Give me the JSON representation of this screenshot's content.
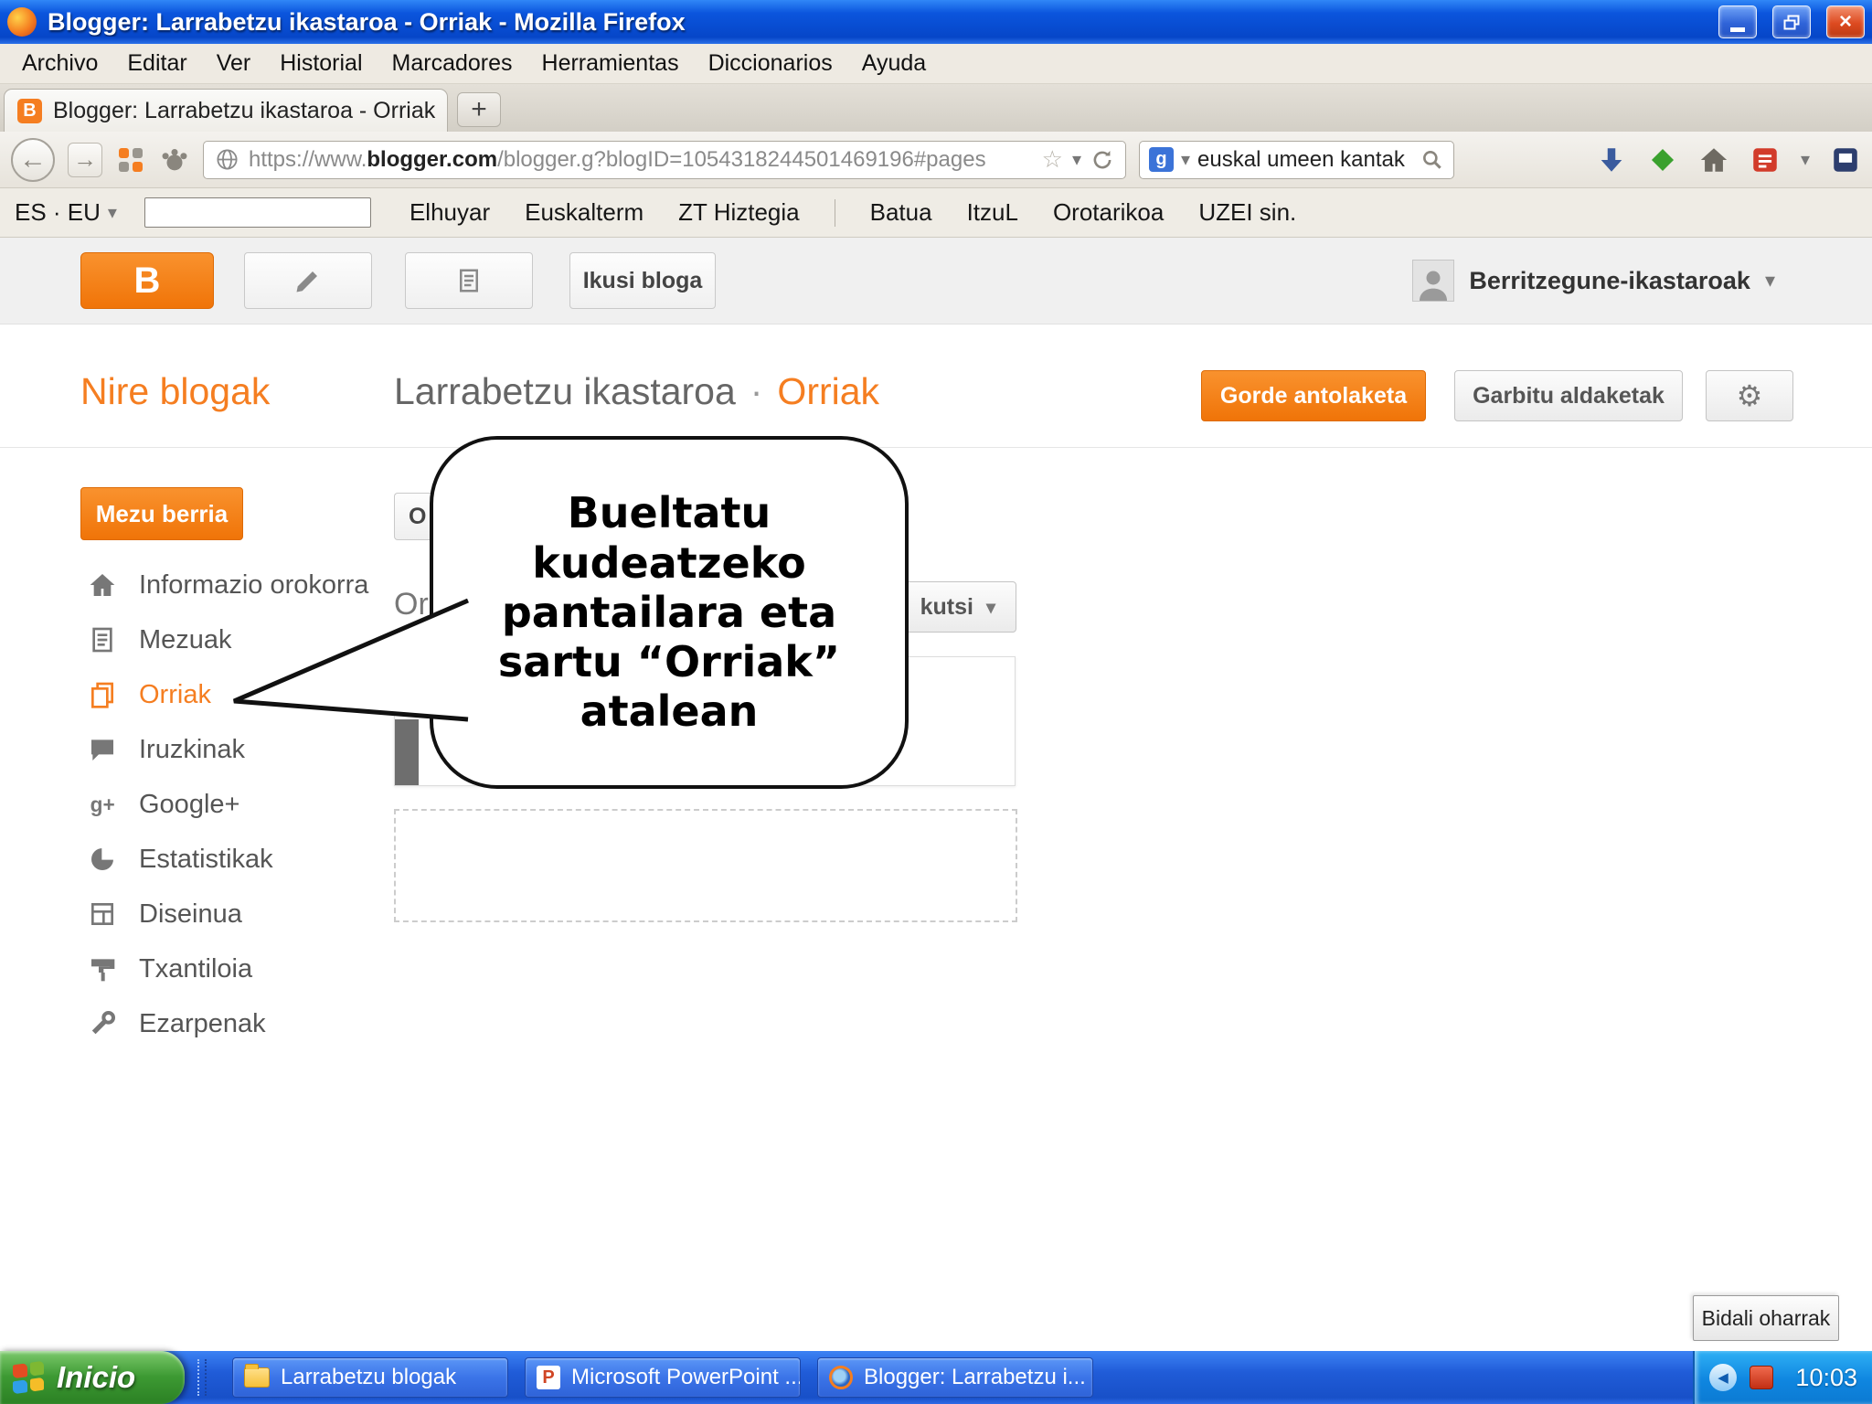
{
  "titlebar": {
    "title": "Blogger: Larrabetzu ikastaroa - Orriak - Mozilla Firefox"
  },
  "menubar": {
    "items": [
      "Archivo",
      "Editar",
      "Ver",
      "Historial",
      "Marcadores",
      "Herramientas",
      "Diccionarios",
      "Ayuda"
    ]
  },
  "tabbar": {
    "tab_title": "Blogger: Larrabetzu ikastaroa - Orriak",
    "new_tab": "+",
    "favicon_letter": "B"
  },
  "navbar": {
    "url_prefix": "https://www.",
    "url_domain": "blogger.com",
    "url_path": "/blogger.g?blogID=1054318244501469196#pages",
    "search_value": "euskal umeen kantak"
  },
  "dictbar": {
    "lang_selector": "ES · EU",
    "links": [
      "Elhuyar",
      "Euskalterm",
      "ZT Hiztegia",
      "Batua",
      "ItzuL",
      "Orotarikoa",
      "UZEI sin."
    ]
  },
  "blogger_bar": {
    "logo_letter": "B",
    "view_blog_label": "Ikusi bloga",
    "account_name": "Berritzegune-ikastaroak"
  },
  "page_header": {
    "my_blogs": "Nire blogak",
    "blog_title": "Larrabetzu ikastaroa",
    "dot": "·",
    "section": "Orriak",
    "save_label": "Gorde antolaketa",
    "discard_label": "Garbitu aldaketak"
  },
  "sidebar": {
    "new_post_label": "Mezu berria",
    "items": [
      {
        "label": "Informazio orokorra"
      },
      {
        "label": "Mezuak"
      },
      {
        "label": "Orriak"
      },
      {
        "label": "Iruzkinak"
      },
      {
        "label": "Google+"
      },
      {
        "label": "Estatistikak"
      },
      {
        "label": "Diseinua"
      },
      {
        "label": "Txantiloia"
      },
      {
        "label": "Ezarpenak"
      }
    ]
  },
  "content": {
    "partial_button_text": "O",
    "partial_heading": "Or",
    "partial_dropdown": "kutsi"
  },
  "callout": {
    "text": "Bueltatu kudeatzeko pantailara eta sartu “Orriak” atalean"
  },
  "feedback": {
    "label": "Bidali oharrak"
  },
  "taskbar": {
    "start_label": "Inicio",
    "tasks": [
      {
        "title": "Larrabetzu blogak"
      },
      {
        "title": "Microsoft PowerPoint ..."
      },
      {
        "title": "Blogger: Larrabetzu i..."
      }
    ],
    "clock": "10:03"
  },
  "icons": {
    "close": "×",
    "back_arrow": "←",
    "forward_arrow": "→",
    "caret_down": "▾",
    "star": "☆",
    "gear": "⚙",
    "google_letter": "g",
    "tray_chevron": "◀",
    "plus_partial": "g+"
  },
  "colors": {
    "blogger_orange": "#f57e21",
    "titlebar_blue": "#0b55dd",
    "taskbar_blue": "#205cd8",
    "start_green": "#3d9a33"
  }
}
